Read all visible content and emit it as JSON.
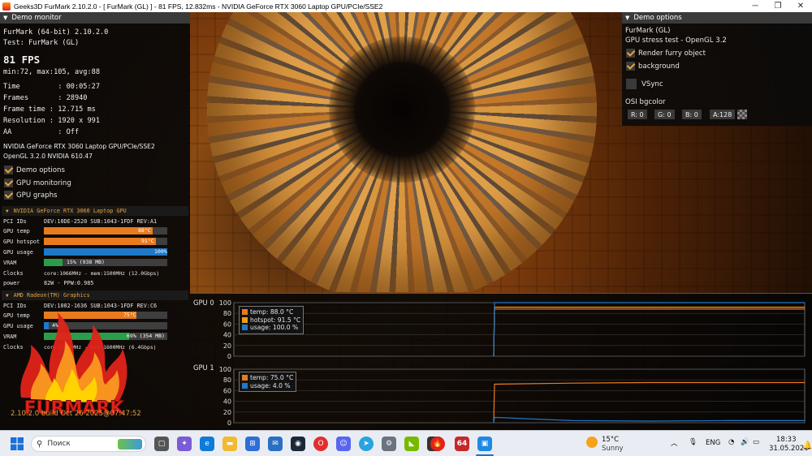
{
  "window": {
    "title": "Geeks3D FurMark 2.10.2.0 - [ FurMark (GL) ] - 81 FPS, 12.832ms - NVIDIA GeForce RTX 3060 Laptop GPU/PCIe/SSE2",
    "minimize": "─",
    "maximize": "❐",
    "close": "✕"
  },
  "demo_monitor": {
    "header": "Demo monitor",
    "line_app": "FurMark (64-bit) 2.10.2.0",
    "line_test": "Test: FurMark (GL)",
    "fps": "81 FPS",
    "fps_stats": "min:72, max:105, avg:88",
    "time": "Time         : 00:05:27",
    "frames": "Frames       : 28940",
    "frame_time": "Frame time : 12.715 ms",
    "resolution": "Resolution : 1920 x 991",
    "aa": "AA           : Off",
    "renderer": "NVIDIA GeForce RTX 3060 Laptop GPU/PCIe/SSE2",
    "opengl": "OpenGL 3.2.0 NVIDIA 610.47",
    "checks": [
      {
        "label": "Demo options",
        "checked": true
      },
      {
        "label": "GPU monitoring",
        "checked": true
      },
      {
        "label": "GPU graphs",
        "checked": true
      }
    ]
  },
  "gpu0": {
    "name": "NVIDIA GeForce RTX 3060 Laptop GPU",
    "pci_label": "PCI IDs",
    "pci_value": "DEV:10DE-2520 SUB:1043-1FDF REV:A1",
    "temp_label": "GPU temp",
    "temp_value": "88°C",
    "temp_fill": 0.88,
    "hotspot_label": "GPU hotspot",
    "hotspot_value": "91°C",
    "hotspot_fill": 0.91,
    "usage_label": "GPU usage",
    "usage_value": "100%",
    "usage_fill": 1.0,
    "vram_label": "VRAM",
    "vram_value": "15% (938 MB)",
    "vram_fill": 0.15,
    "clocks_label": "Clocks",
    "clocks_value": "core:1066MHz - mem:1500MHz (12.0Gbps)",
    "power_label": "power",
    "power_value": "82W - PPW:0.985"
  },
  "gpu1": {
    "name": "AMD Radeon(TM) Graphics",
    "pci_label": "PCI IDs",
    "pci_value": "DEV:1002-1636 SUB:1043-1FDF REV:C6",
    "temp_label": "GPU temp",
    "temp_value": "75°C",
    "temp_fill": 0.75,
    "usage_label": "GPU usage",
    "usage_value": "4%",
    "usage_fill": 0.04,
    "vram_label": "VRAM",
    "vram_value": "69% (354 MB)",
    "vram_fill": 0.69,
    "clocks_label": "Clocks",
    "clocks_value": "core:1400MHz - mem:1600MHz (6.4Gbps)"
  },
  "logo_text": "FURMARK",
  "build": "2.10.2.0 build Oct 26 2025@07:47:52",
  "demo_options": {
    "header": "Demo options",
    "title": "FurMark (GL)",
    "subtitle": "GPU stress test - OpenGL 3.2",
    "render_furry": {
      "label": "Render furry object",
      "checked": true
    },
    "background": {
      "label": "background",
      "checked": true
    },
    "vsync": {
      "label": "VSync",
      "checked": false
    },
    "osi_label": "OSI bgcolor",
    "r": "R: 0",
    "g": "G: 0",
    "b": "B: 0",
    "a": "A:128"
  },
  "graphs": {
    "gpu0_label": "GPU 0",
    "gpu1_label": "GPU 1",
    "y_ticks": [
      "100",
      "80",
      "60",
      "40",
      "20",
      "0"
    ],
    "gpu0_legend": [
      {
        "label": "temp: 88.0 °C",
        "color": "#e87b1e"
      },
      {
        "label": "hotspot: 91.5 °C",
        "color": "#f39c12"
      },
      {
        "label": "usage: 100.0 %",
        "color": "#1f78c8"
      }
    ],
    "gpu1_legend": [
      {
        "label": "temp: 75.0 °C",
        "color": "#e87b1e"
      },
      {
        "label": "usage: 4.0 %",
        "color": "#1f78c8"
      }
    ]
  },
  "taskbar": {
    "search_placeholder": "Поиск",
    "weather_temp": "15°C",
    "weather_desc": "Sunny",
    "lang": "ENG",
    "time": "18:33",
    "date": "31.05.2026",
    "badge": "64"
  },
  "chart_data": [
    {
      "type": "line",
      "title": "GPU 0",
      "ylim": [
        0,
        100
      ],
      "grid": true,
      "legend": "top-left",
      "series": [
        {
          "name": "temp: 88.0 °C",
          "values": [
            88,
            88,
            88,
            88,
            88
          ]
        },
        {
          "name": "hotspot: 91.5 °C",
          "values": [
            91.5,
            91.5,
            91.5,
            91.5,
            91.5
          ]
        },
        {
          "name": "usage: 100.0 %",
          "values": [
            100,
            100,
            100,
            100,
            100
          ]
        }
      ]
    },
    {
      "type": "line",
      "title": "GPU 1",
      "ylim": [
        0,
        100
      ],
      "grid": true,
      "legend": "top-left",
      "series": [
        {
          "name": "temp: 75.0 °C",
          "values": [
            72,
            74,
            75,
            75,
            75
          ]
        },
        {
          "name": "usage: 4.0 %",
          "values": [
            10,
            4,
            3,
            4,
            4
          ]
        }
      ]
    }
  ]
}
